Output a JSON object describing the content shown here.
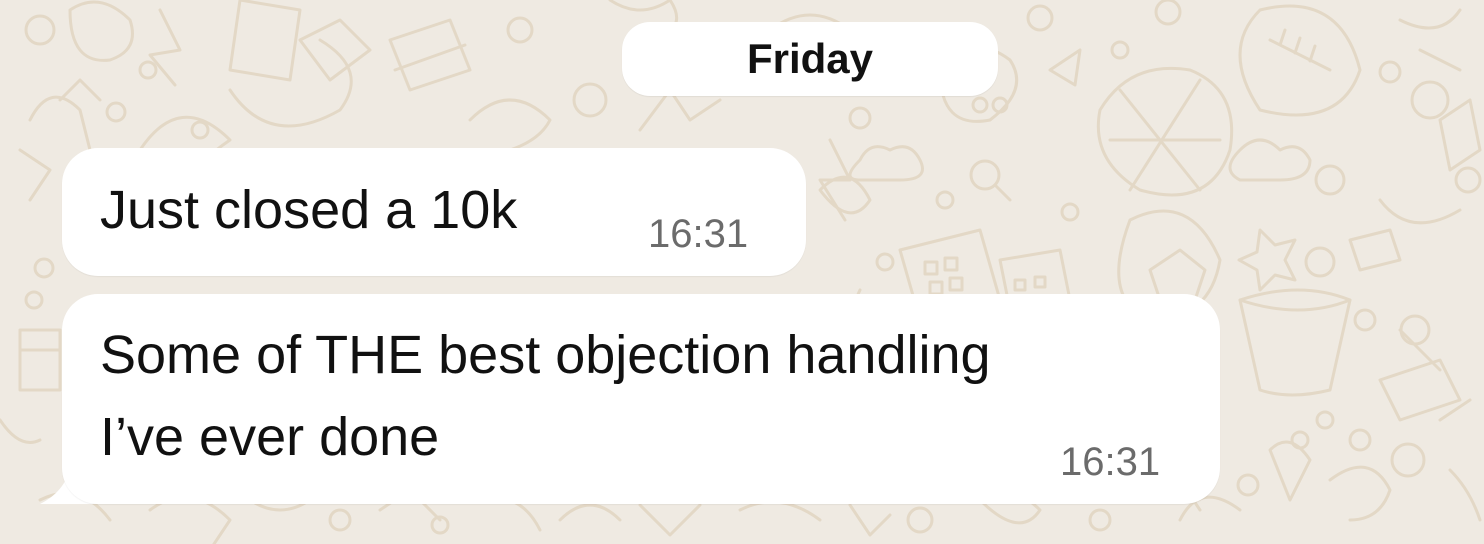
{
  "date_separator": {
    "label": "Friday"
  },
  "messages": [
    {
      "text": "Just closed a 10k",
      "time": "16:31"
    },
    {
      "lines": [
        "Some of THE best objection handling",
        "I’ve ever done"
      ],
      "time": "16:31"
    }
  ],
  "colors": {
    "wallpaper": "#efeae2",
    "doodle": "#e3d8c6",
    "bubble": "#ffffff",
    "text": "#111111",
    "timestamp": "#6b6b6b"
  }
}
